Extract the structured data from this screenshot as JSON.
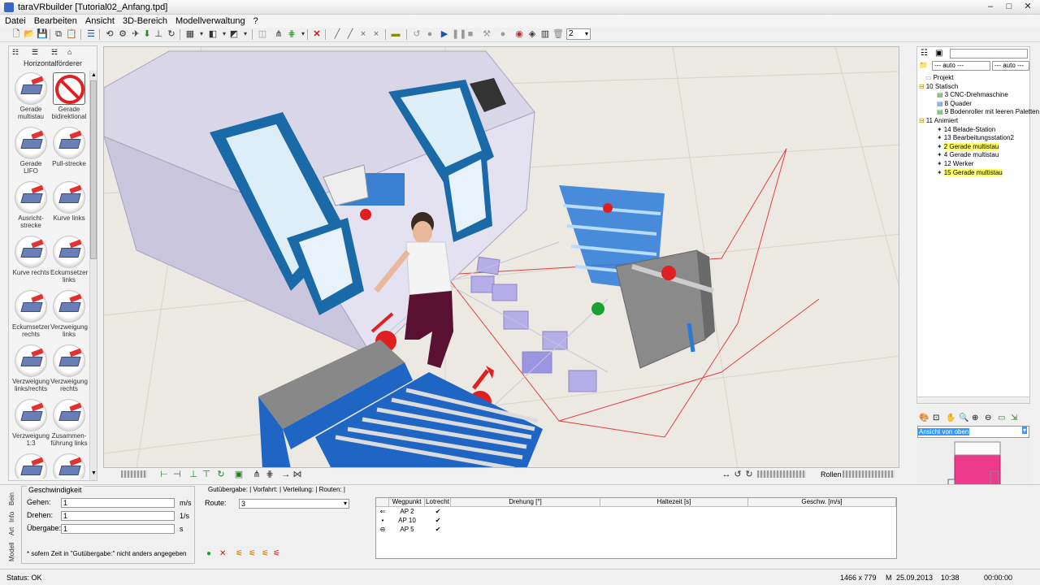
{
  "window": {
    "title": "taraVRbuilder [Tutorial02_Anfang.tpd]",
    "buttons": [
      "–",
      "□",
      "✕"
    ]
  },
  "menu": [
    "Datei",
    "Bearbeiten",
    "Ansicht",
    "3D-Bereich",
    "Modellverwaltung",
    "?"
  ],
  "toolbar": {
    "zoom_value": "2"
  },
  "palette": {
    "title": "Horizontalförderer",
    "items": [
      "Gerade multistau",
      "Gerade bidirektional",
      "Gerade LIFO",
      "Pull-strecke",
      "Ausricht-strecke",
      "Kurve links",
      "Kurve rechts",
      "Eckumsetzer links",
      "Eckumsetzer rechts",
      "Verzweigung links",
      "Verzweigung links/rechts",
      "Verzweigung rechts",
      "Verzweigung 1:3",
      "Zusammen-führung links",
      "",
      ""
    ]
  },
  "viewport_bar": {
    "rollen_label": "Rollen"
  },
  "tree": {
    "combo1": "--- auto ---",
    "combo2": "--- auto ---",
    "root": "Projekt",
    "groups": [
      {
        "label": "10 Statisch",
        "items": [
          "3 CNC-Drehmaschine",
          "8 Quader",
          "9 Bodenroller mit leeren Paletten"
        ]
      },
      {
        "label": "11 Animiert",
        "items": [
          "14 Belade-Station",
          "13 Bearbeitungsstation2",
          "2 Gerade multistau",
          "4 Gerade multistau",
          "12 Werker",
          "15 Gerade multistau"
        ]
      }
    ]
  },
  "view_select": "Ansicht von oben",
  "side_tabs": [
    "Bein",
    "Info",
    "Art",
    "Modell"
  ],
  "speed": {
    "group": "Geschwindigkeit",
    "gehen_label": "Gehen:",
    "gehen_value": "1",
    "gehen_unit": "m/s",
    "drehen_label": "Drehen:",
    "drehen_value": "1",
    "drehen_unit": "1/s",
    "uebergabe_label": "Übergabe:*",
    "uebergabe_value": "1",
    "uebergabe_unit": "s",
    "note": "* sofern Zeit in \"Gutübergabe:\" nicht anders angegeben"
  },
  "route_tabs": [
    "Gutübergabe:",
    "Vorfahrt:",
    "Verteilung:",
    "Routen:"
  ],
  "route": {
    "label": "Route:",
    "value": "3"
  },
  "table": {
    "headers": [
      "Wegpunkt",
      "Lotrecht",
      "Drehung [°]",
      "Haltezeit [s]",
      "Geschw. [m/s]"
    ],
    "rows": [
      {
        "wegpunkt": "AP 2",
        "lotrecht": "✔"
      },
      {
        "wegpunkt": "AP 10",
        "lotrecht": "✔"
      },
      {
        "wegpunkt": "AP 5",
        "lotrecht": "✔"
      }
    ]
  },
  "status": {
    "text": "Status: OK",
    "resolution": "1466 x 779",
    "mode": "M",
    "date": "25.09.2013",
    "time": "10:38",
    "sim_time": "00:00:00"
  }
}
